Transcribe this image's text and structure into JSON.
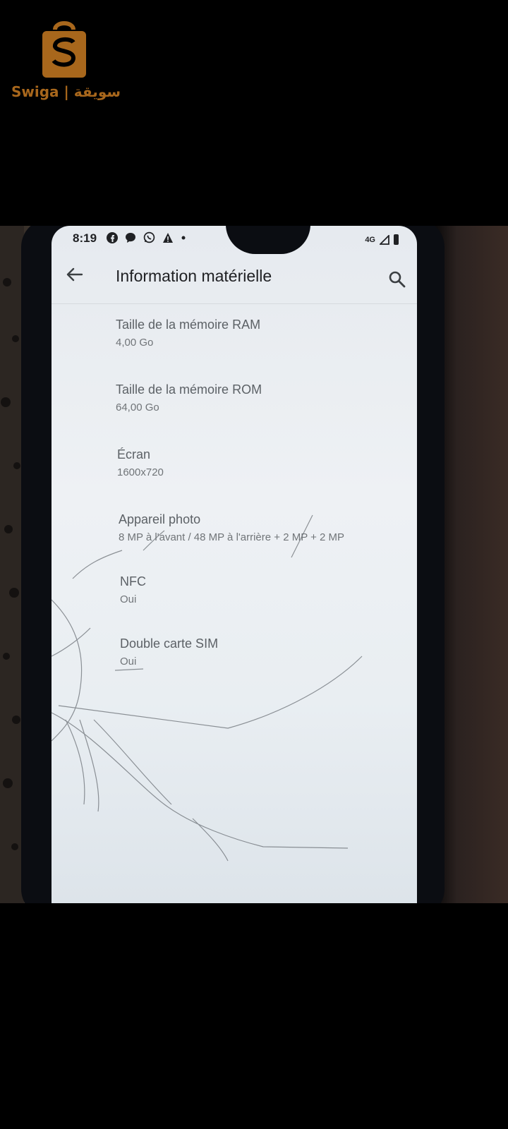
{
  "watermark": {
    "brand": "Swiga | سويقة",
    "brand_color": "#a8671c"
  },
  "status_bar": {
    "time": "8:19",
    "icons": [
      "facebook-icon",
      "messenger-icon",
      "whatsapp-icon",
      "alert-icon",
      "dot-icon"
    ],
    "network": "4G",
    "signal": "signal-icon",
    "battery": "battery-icon"
  },
  "app_bar": {
    "title": "Information matérielle",
    "back_icon": "arrow-back-icon",
    "search_icon": "search-icon"
  },
  "items": [
    {
      "title": "Taille de la mémoire RAM",
      "value": "4,00 Go"
    },
    {
      "title": "Taille de la mémoire ROM",
      "value": "64,00 Go"
    },
    {
      "title": "Écran",
      "value": "1600x720"
    },
    {
      "title": "Appareil photo",
      "value": "8 MP à l'avant / 48 MP à l'arrière + 2 MP + 2 MP"
    },
    {
      "title": "NFC",
      "value": "Oui"
    },
    {
      "title": "Double carte SIM",
      "value": "Oui"
    }
  ]
}
